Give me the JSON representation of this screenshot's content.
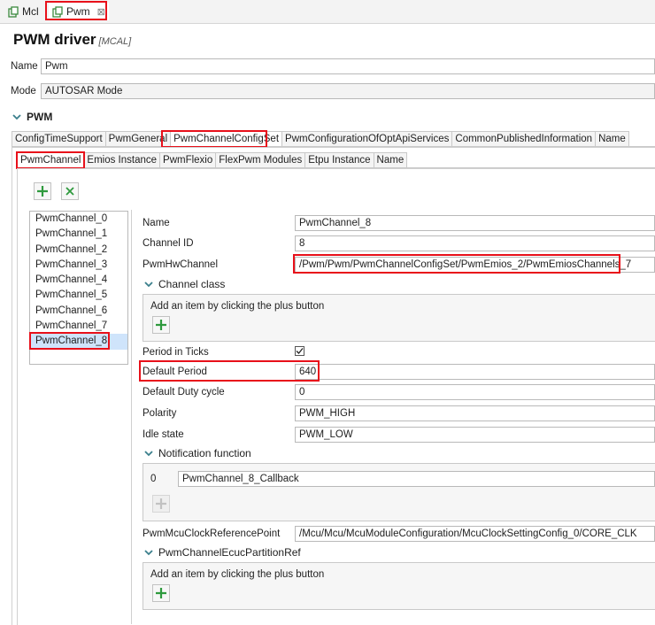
{
  "editor_tabs": [
    {
      "label": "Mcl"
    },
    {
      "label": "Pwm"
    }
  ],
  "header": {
    "title": "PWM driver",
    "subtitle": "[MCAL]"
  },
  "top_fields": {
    "name_label": "Name",
    "name_value": "Pwm",
    "mode_label": "Mode",
    "mode_value": "AUTOSAR Mode"
  },
  "section_title": "PWM",
  "main_tabs": [
    "ConfigTimeSupport",
    "PwmGeneral",
    "PwmChannelConfigSet",
    "PwmConfigurationOfOptApiServices",
    "CommonPublishedInformation",
    "Name"
  ],
  "sub_tabs": [
    "PwmChannel",
    "Emios Instance",
    "PwmFlexio",
    "FlexPwm Modules",
    "Etpu Instance",
    "Name"
  ],
  "channels": [
    "PwmChannel_0",
    "PwmChannel_1",
    "PwmChannel_2",
    "PwmChannel_3",
    "PwmChannel_4",
    "PwmChannel_5",
    "PwmChannel_6",
    "PwmChannel_7",
    "PwmChannel_8"
  ],
  "detail": {
    "name_label": "Name",
    "name_value": "PwmChannel_8",
    "channel_id_label": "Channel ID",
    "channel_id_value": "8",
    "hw_channel_label": "PwmHwChannel",
    "hw_channel_value": "/Pwm/Pwm/PwmChannelConfigSet/PwmEmios_2/PwmEmiosChannels_7",
    "channel_class_label": "Channel class",
    "add_hint": "Add an item by clicking the plus button",
    "period_ticks_label": "Period in Ticks",
    "period_ticks_checked": true,
    "default_period_label": "Default Period",
    "default_period_value": "640",
    "duty_label": "Default Duty cycle",
    "duty_value": "0",
    "polarity_label": "Polarity",
    "polarity_value": "PWM_HIGH",
    "idle_label": "Idle state",
    "idle_value": "PWM_LOW",
    "notification_label": "Notification function",
    "notification_index": "0",
    "notification_value": "PwmChannel_8_Callback",
    "clock_ref_label": "PwmMcuClockReferencePoint",
    "clock_ref_value": "/Mcu/Mcu/McuModuleConfiguration/McuClockSettingConfig_0/CORE_CLK",
    "partition_label": "PwmChannelEcucPartitionRef",
    "add_hint_2": "Add an item by clicking the plus button"
  },
  "colors": {
    "accent_green": "#2f9a3e",
    "highlight_red": "#e8101a",
    "selection_blue": "#cfe4fb"
  }
}
